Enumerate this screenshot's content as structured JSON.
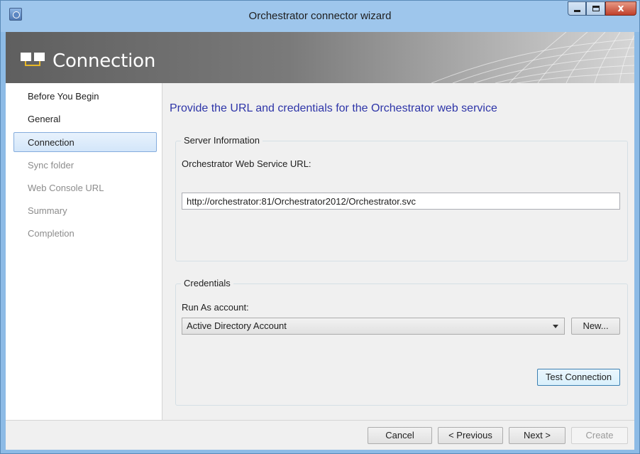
{
  "window": {
    "title": "Orchestrator connector wizard",
    "close_glyph": "x",
    "accent_color": "#8dbbe6"
  },
  "header": {
    "title": "Connection",
    "icon": "wizard-panes-icon"
  },
  "nav": {
    "items": [
      {
        "label": "Before You Begin",
        "state": "normal"
      },
      {
        "label": "General",
        "state": "normal"
      },
      {
        "label": "Connection",
        "state": "selected"
      },
      {
        "label": "Sync folder",
        "state": "disabled"
      },
      {
        "label": "Web Console URL",
        "state": "disabled"
      },
      {
        "label": "Summary",
        "state": "disabled"
      },
      {
        "label": "Completion",
        "state": "disabled"
      }
    ]
  },
  "main": {
    "heading": "Provide the URL and credentials for the Orchestrator web service",
    "heading_color": "#2e35a8",
    "server_group": {
      "legend": "Server Information",
      "url_label": "Orchestrator Web Service URL:",
      "url_value": "http://orchestrator:81/Orchestrator2012/Orchestrator.svc"
    },
    "credentials_group": {
      "legend": "Credentials",
      "run_as_label": "Run As account:",
      "run_as_value": "Active Directory Account",
      "new_button": "New...",
      "test_button": "Test Connection"
    }
  },
  "footer": {
    "cancel": "Cancel",
    "previous": "< Previous",
    "next": "Next >",
    "create": "Create"
  }
}
